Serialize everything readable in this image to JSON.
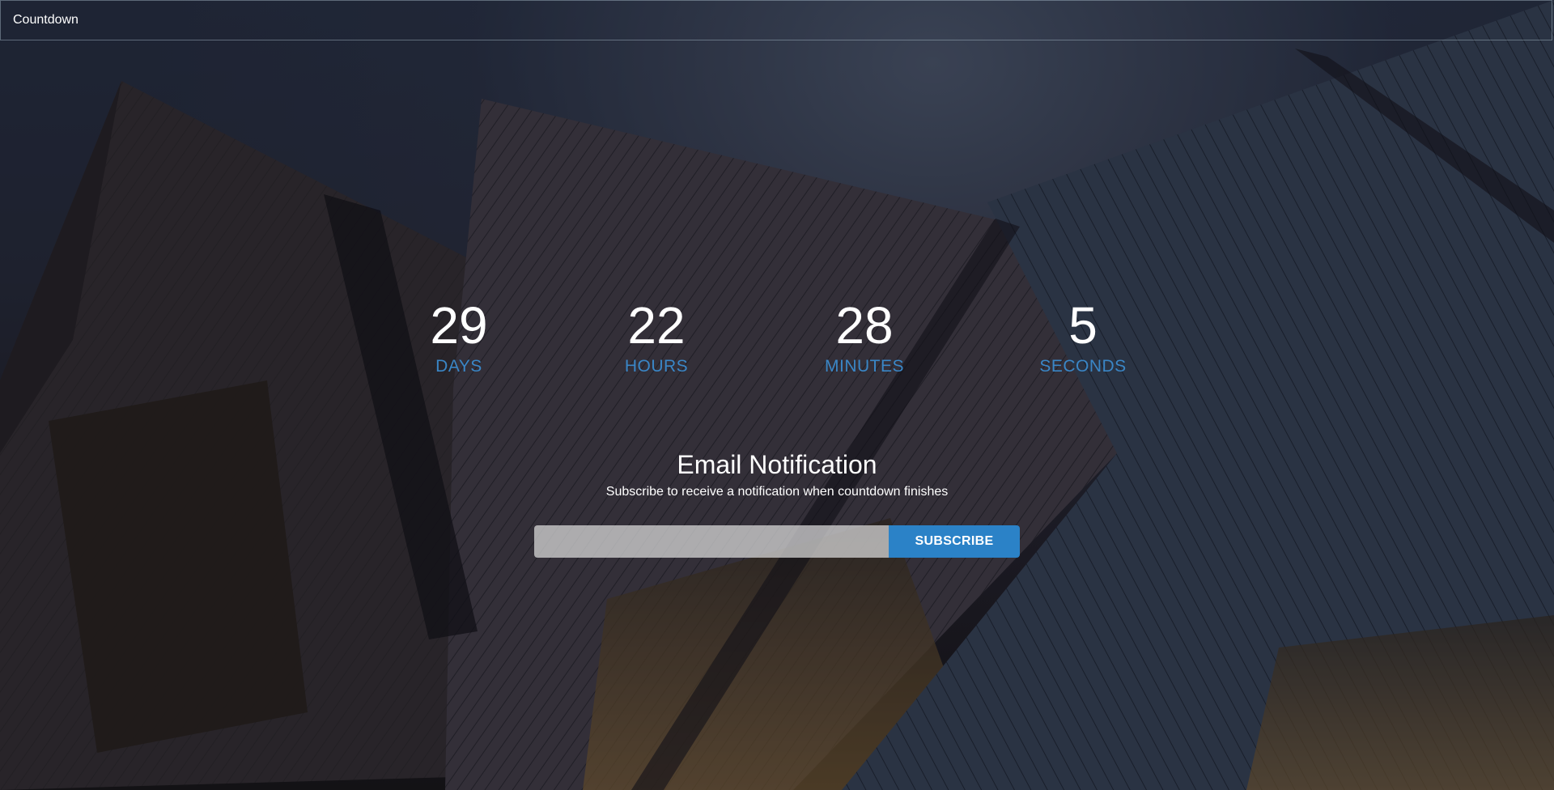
{
  "header": {
    "brand": "Countdown"
  },
  "countdown": {
    "units": [
      {
        "value": "29",
        "label": "DAYS"
      },
      {
        "value": "22",
        "label": "HOURS"
      },
      {
        "value": "28",
        "label": "MINUTES"
      },
      {
        "value": "5",
        "label": "SECONDS"
      }
    ]
  },
  "notification": {
    "title": "Email Notification",
    "subtitle": "Subscribe to receive a notification when countdown finishes",
    "email_placeholder": "",
    "email_value": "",
    "subscribe_label": "SUBSCRIBE"
  },
  "colors": {
    "accent": "#2b82c7",
    "label": "#3a86c6"
  }
}
